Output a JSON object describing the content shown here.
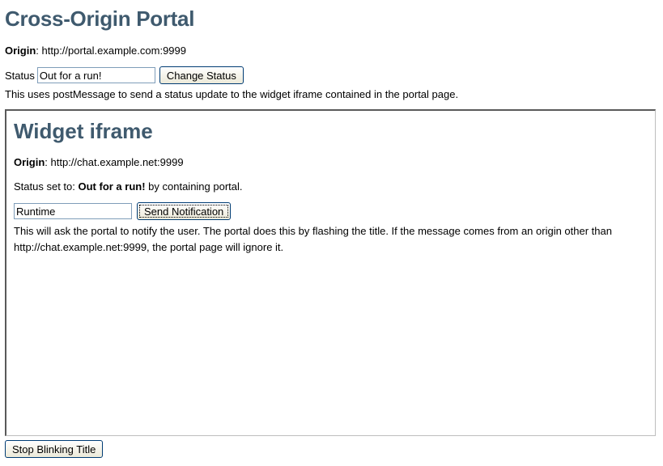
{
  "portal": {
    "title": "Cross-Origin Portal",
    "origin_label": "Origin",
    "origin_value": ": http://portal.example.com:9999",
    "status_label": "Status",
    "status_value": "Out for a run!",
    "change_status_label": "Change Status",
    "description": "This uses postMessage to send a status update to the widget iframe contained in the portal page.",
    "stop_blinking_label": "Stop Blinking Title"
  },
  "widget": {
    "title": "Widget iframe",
    "origin_label": "Origin",
    "origin_value": ": http://chat.example.net:9999",
    "status_prefix": "Status set to: ",
    "status_value": "Out for a run!",
    "status_suffix": " by containing portal.",
    "notification_value": "Runtime",
    "send_notification_label": "Send Notification",
    "description": "This will ask the portal to notify the user. The portal does this by flashing the title. If the message comes from an origin other than http://chat.example.net:9999, the portal page will ignore it."
  },
  "colors": {
    "heading": "#3f5a6e",
    "input_border": "#7f9db9",
    "button_border": "#003c74"
  }
}
